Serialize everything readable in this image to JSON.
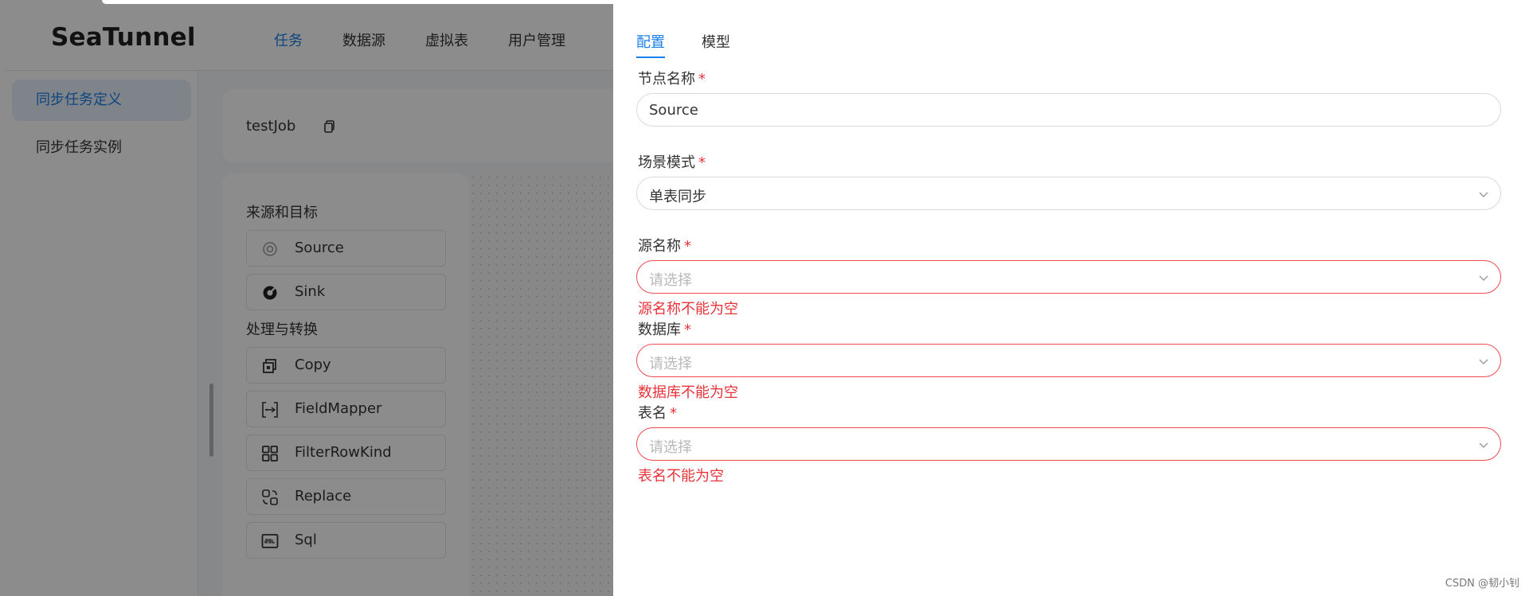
{
  "app": {
    "logo": "SeaTunnel",
    "nav": [
      {
        "label": "任务",
        "active": true
      },
      {
        "label": "数据源",
        "active": false
      },
      {
        "label": "虚拟表",
        "active": false
      },
      {
        "label": "用户管理",
        "active": false
      }
    ],
    "sidebar": [
      {
        "label": "同步任务定义",
        "active": true
      },
      {
        "label": "同步任务实例",
        "active": false
      }
    ],
    "job_name": "testJob"
  },
  "palette": {
    "sources_heading": "来源和目标",
    "sources": [
      {
        "label": "Source",
        "icon": "source-icon"
      },
      {
        "label": "Sink",
        "icon": "sink-icon"
      }
    ],
    "transforms_heading": "处理与转换",
    "transforms": [
      {
        "label": "Copy",
        "icon": "copy-icon"
      },
      {
        "label": "FieldMapper",
        "icon": "field-mapper-icon"
      },
      {
        "label": "FilterRowKind",
        "icon": "grid-icon"
      },
      {
        "label": "Replace",
        "icon": "replace-icon"
      },
      {
        "label": "Sql",
        "icon": "sql-icon"
      }
    ]
  },
  "drawer": {
    "tabs": [
      {
        "label": "配置",
        "active": true
      },
      {
        "label": "模型",
        "active": false
      }
    ],
    "fields": {
      "node_name": {
        "label": "节点名称",
        "required_mark": "*",
        "value": "Source"
      },
      "scene_mode": {
        "label": "场景模式",
        "required_mark": "*",
        "value": "单表同步"
      },
      "source_name": {
        "label": "源名称",
        "required_mark": "*",
        "placeholder": "请选择",
        "error": "源名称不能为空"
      },
      "database": {
        "label": "数据库",
        "required_mark": "*",
        "placeholder": "请选择",
        "error": "数据库不能为空"
      },
      "table_name": {
        "label": "表名",
        "required_mark": "*",
        "placeholder": "请选择",
        "error": "表名不能为空"
      }
    }
  },
  "watermark": "CSDN @韧小钊",
  "colors": {
    "accent": "#1a7fe8",
    "error": "#e8333a",
    "overlay": "rgba(0,0,0,0.45)"
  }
}
